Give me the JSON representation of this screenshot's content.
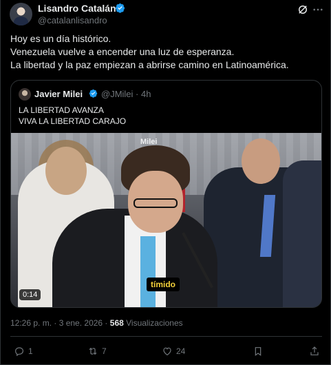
{
  "author": {
    "name": "Lisandro Catalán",
    "handle": "@catalanlisandro"
  },
  "tweet": {
    "lines": [
      "Hoy es un día histórico.",
      "Venezuela vuelve a encender una luz de esperanza.",
      "La libertad y la paz empiezan a abrirse camino en Latinoamérica."
    ]
  },
  "quote": {
    "name": "Javier Milei",
    "handle_time": "@JMilei · 4h",
    "lines": [
      "LA LIBERTAD AVANZA",
      "VIVA LA LIBERTAD CARAJO"
    ],
    "video": {
      "duration": "0:14",
      "caption": "tímido",
      "watermark": "Milei"
    }
  },
  "meta": {
    "timestamp": "12:26 p. m. · 3 ene. 2026 · ",
    "views_count": "568",
    "views_label": " Visualizaciones"
  },
  "actions": {
    "replies": "1",
    "reposts": "7",
    "likes": "24"
  },
  "colors": {
    "background": "#000000",
    "text": "#e7e9ea",
    "muted": "#71767b",
    "border": "#2f3336",
    "verified": "#1d9bf0"
  },
  "icons": [
    "verified-badge-icon",
    "grok-icon",
    "more-icon",
    "reply-icon",
    "repost-icon",
    "like-icon",
    "bookmark-icon",
    "share-icon"
  ]
}
